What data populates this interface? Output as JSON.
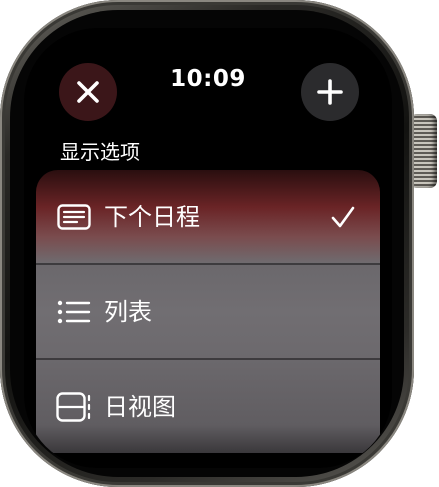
{
  "status_bar": {
    "time": "10:09"
  },
  "header": {
    "close_icon": "xmark-icon",
    "add_icon": "plus-icon"
  },
  "section": {
    "title": "显示选项"
  },
  "options": [
    {
      "label": "下个日程",
      "icon": "up-next-icon",
      "selected": true
    },
    {
      "label": "列表",
      "icon": "list-icon",
      "selected": false
    },
    {
      "label": "日视图",
      "icon": "day-view-icon",
      "selected": false
    }
  ],
  "colors": {
    "close_button_bg": "#3b1619",
    "add_button_bg": "#2b2b2d",
    "selected_row_tint": "#6a2426",
    "row_bg": "#6f6c70",
    "text": "#ffffff"
  }
}
